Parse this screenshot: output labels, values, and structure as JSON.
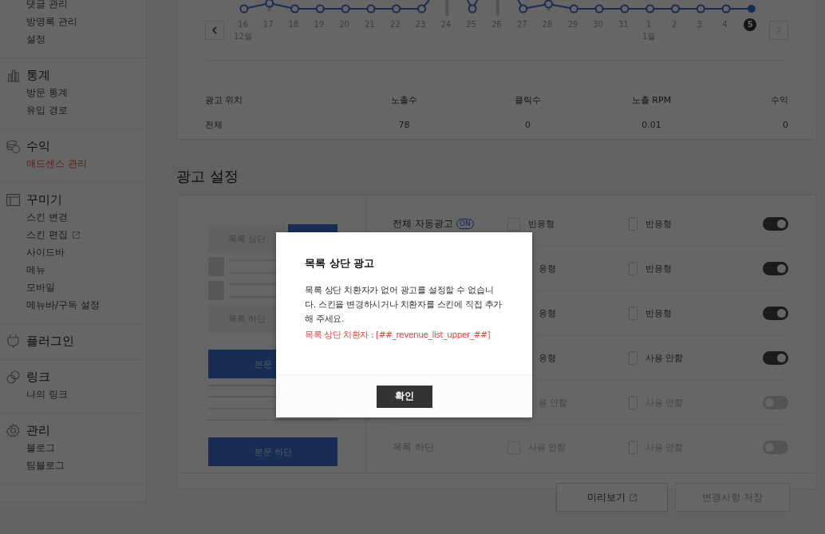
{
  "sidebar": {
    "sections": [
      {
        "items": [
          {
            "label": "댓글 관리",
            "selected": false
          },
          {
            "label": "방명록 관리",
            "selected": false
          },
          {
            "label": "설정",
            "selected": false
          }
        ]
      },
      {
        "title": "통계",
        "items": [
          {
            "label": "방문 통계",
            "selected": false
          },
          {
            "label": "유입 경로",
            "selected": false
          }
        ]
      },
      {
        "title": "수익",
        "items": [
          {
            "label": "애드센스 관리",
            "selected": true
          }
        ]
      },
      {
        "title": "꾸미기",
        "items": [
          {
            "label": "스킨 변경",
            "selected": false
          },
          {
            "label": "스킨 편집",
            "selected": false,
            "external": true
          },
          {
            "label": "사이드바",
            "selected": false
          },
          {
            "label": "메뉴",
            "selected": false
          },
          {
            "label": "모바일",
            "selected": false
          },
          {
            "label": "메뉴바/구독 설정",
            "selected": false
          }
        ]
      },
      {
        "title": "플러그인"
      },
      {
        "title": "링크",
        "items": [
          {
            "label": "나의 링크",
            "selected": false
          }
        ]
      },
      {
        "title": "관리",
        "items": [
          {
            "label": "블로그",
            "selected": false
          },
          {
            "label": "팀블로그",
            "selected": false
          }
        ]
      }
    ]
  },
  "stats": {
    "dates": [
      {
        "day": "16",
        "month": "12월",
        "selected": false
      },
      {
        "day": "17",
        "selected": false
      },
      {
        "day": "18",
        "selected": false
      },
      {
        "day": "19",
        "selected": false
      },
      {
        "day": "20",
        "selected": false
      },
      {
        "day": "21",
        "selected": false
      },
      {
        "day": "22",
        "selected": false
      },
      {
        "day": "23",
        "selected": false
      },
      {
        "day": "24",
        "selected": false
      },
      {
        "day": "25",
        "selected": false
      },
      {
        "day": "26",
        "selected": false
      },
      {
        "day": "27",
        "selected": false
      },
      {
        "day": "28",
        "selected": false
      },
      {
        "day": "29",
        "selected": false
      },
      {
        "day": "30",
        "selected": false
      },
      {
        "day": "31",
        "selected": false
      },
      {
        "day": "1",
        "month": "1월",
        "selected": false
      },
      {
        "day": "2",
        "selected": false
      },
      {
        "day": "3",
        "selected": false
      },
      {
        "day": "4",
        "selected": false
      },
      {
        "day": "5",
        "selected": true
      }
    ],
    "next_disabled": true,
    "table": {
      "columns": [
        "광고 위치",
        "노출수",
        "클릭수",
        "노출 RPM",
        "수익"
      ],
      "rows": [
        [
          "전체",
          "78",
          "0",
          "0.01",
          "0"
        ]
      ]
    }
  },
  "ad_settings": {
    "title": "광고 설정",
    "preview": [
      {
        "kind": "slot",
        "label": "목록 상단",
        "side_ad": true
      },
      {
        "kind": "list"
      },
      {
        "kind": "slot",
        "label": "목록 하단"
      },
      {
        "kind": "ad",
        "label": "본문"
      },
      {
        "kind": "lines"
      },
      {
        "kind": "ad",
        "label": "본문 하단"
      }
    ],
    "rows": [
      {
        "label": "전체 자동광고",
        "badge": "ON",
        "checked": false,
        "pc": "반응형",
        "mobile": "반응형",
        "on": true
      },
      {
        "pc": "응형",
        "mobile": "반응형",
        "on": true
      },
      {
        "pc": "응형",
        "mobile": "반응형",
        "on": true
      },
      {
        "pc": "응형",
        "mobile": "사용 안함",
        "on": true
      },
      {
        "pc": "용 안함",
        "mobile": "사용 안함",
        "on": false
      },
      {
        "label": "목록 하단",
        "checked": false,
        "pc": "사용 안함",
        "mobile": "사용 안함",
        "on": false
      }
    ],
    "buttons": [
      {
        "label": "미리보기",
        "external": true,
        "disabled": false
      },
      {
        "label": "변경사항 저장",
        "disabled": true
      }
    ]
  },
  "dialog": {
    "title": "목록 상단 광고",
    "message": "목록 상단 치환자가 없어 광고를 설정할 수 없습니다. 스킨을 변경하시거나 치환자를 스킨에 직접 추가해 주세요.",
    "note": "목록 상단 치환자 : [##_revenue_list_upper_##]",
    "button": "확인"
  }
}
